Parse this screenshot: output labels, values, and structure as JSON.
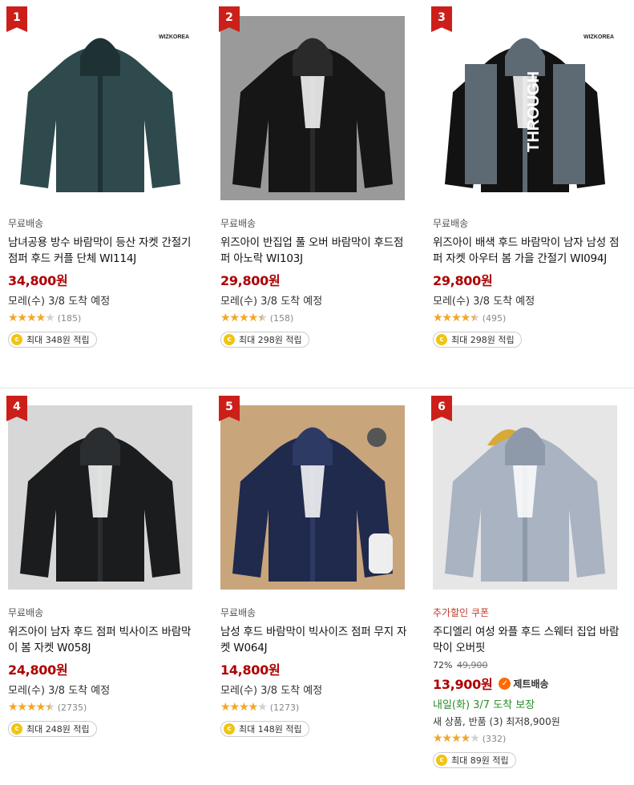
{
  "products": [
    {
      "rank": "1",
      "tag": "무료배송",
      "title": "남녀공용 방수 바람막이 등산 자켓 간절기 점퍼 후드 커플 단체 WI114J",
      "price": "34,800원",
      "delivery": "모레(수) 3/8 도착 예정",
      "rating": 4.0,
      "review_count": "(185)",
      "reward": "최대 348원 적립",
      "photo": {
        "bg": "#ffffff",
        "jacket": "#2f4a4c",
        "trim": "#1f3233",
        "logo": "WIZKOREA"
      }
    },
    {
      "rank": "2",
      "tag": "무료배송",
      "title": "위즈아이 반집업 풀 오버 바람막이 후드점퍼 아노락 WI103J",
      "price": "29,800원",
      "delivery": "모레(수) 3/8 도착 예정",
      "rating": 4.5,
      "review_count": "(158)",
      "reward": "최대 298원 적립",
      "photo": {
        "bg": "#9a9a9a",
        "jacket": "#161616",
        "trim": "#2a2a2a",
        "logo": ""
      }
    },
    {
      "rank": "3",
      "tag": "무료배송",
      "title": "위즈아이 배색 후드 바람막이 남자 남성 점퍼 자켓 아우터 봄 가을 간절기 WI094J",
      "price": "29,800원",
      "delivery": "모레(수) 3/8 도착 예정",
      "rating": 4.5,
      "review_count": "(495)",
      "reward": "최대 298원 적립",
      "photo": {
        "bg": "#ffffff",
        "jacket": "#121212",
        "trim": "#5d6a73",
        "logo": "WIZKOREA",
        "print": "THROUGH"
      }
    },
    {
      "rank": "4",
      "tag": "무료배송",
      "title": "위즈아이 남자 후드 점퍼 빅사이즈 바람막이 봄 자켓 W058J",
      "price": "24,800원",
      "delivery": "모레(수) 3/8 도착 예정",
      "rating": 4.5,
      "review_count": "(2735)",
      "reward": "최대 248원 적립",
      "photo": {
        "bg": "#d7d7d7",
        "jacket": "#1a1c1e",
        "trim": "#2b2e31",
        "logo": ""
      }
    },
    {
      "rank": "5",
      "tag": "무료배송",
      "title": "남성 후드 바람막이 빅사이즈 점퍼 무지 자켓 W064J",
      "price": "14,800원",
      "delivery": "모레(수) 3/8 도착 예정",
      "rating": 4.0,
      "review_count": "(1273)",
      "reward": "최대 148원 적립",
      "photo": {
        "bg": "#c9a57c",
        "jacket": "#1f2a4d",
        "trim": "#2d3a63",
        "logo": ""
      }
    },
    {
      "rank": "6",
      "tag": "추가할인 쿠폰",
      "title": "주디엘리 여성 와플 후드 스웨터 집업 바람막이 오버핏",
      "discount_rate": "72%",
      "original_price": "49,900",
      "price": "13,900원",
      "jet": "제트배송",
      "delivery": "내일(화) 3/7 도착 보장",
      "offers": "새 상품, 반품 (3) 최저8,900원",
      "rating": 4.0,
      "review_count": "(332)",
      "reward": "최대 89원 적립",
      "photo": {
        "bg": "#e6e6e6",
        "jacket": "#a9b3c2",
        "trim": "#8e99a9",
        "logo": "",
        "beanie": "#d6a93a"
      }
    }
  ],
  "star_glyphs": "★★★★★",
  "coin_symbol": "c",
  "jet_symbol": "✓",
  "colors": {
    "price": "#ae0000",
    "rank_badge": "#cc1f1a",
    "star": "#f5a623",
    "coupon_tag": "#c0392b",
    "delivery_green": "#2a8c2a"
  }
}
